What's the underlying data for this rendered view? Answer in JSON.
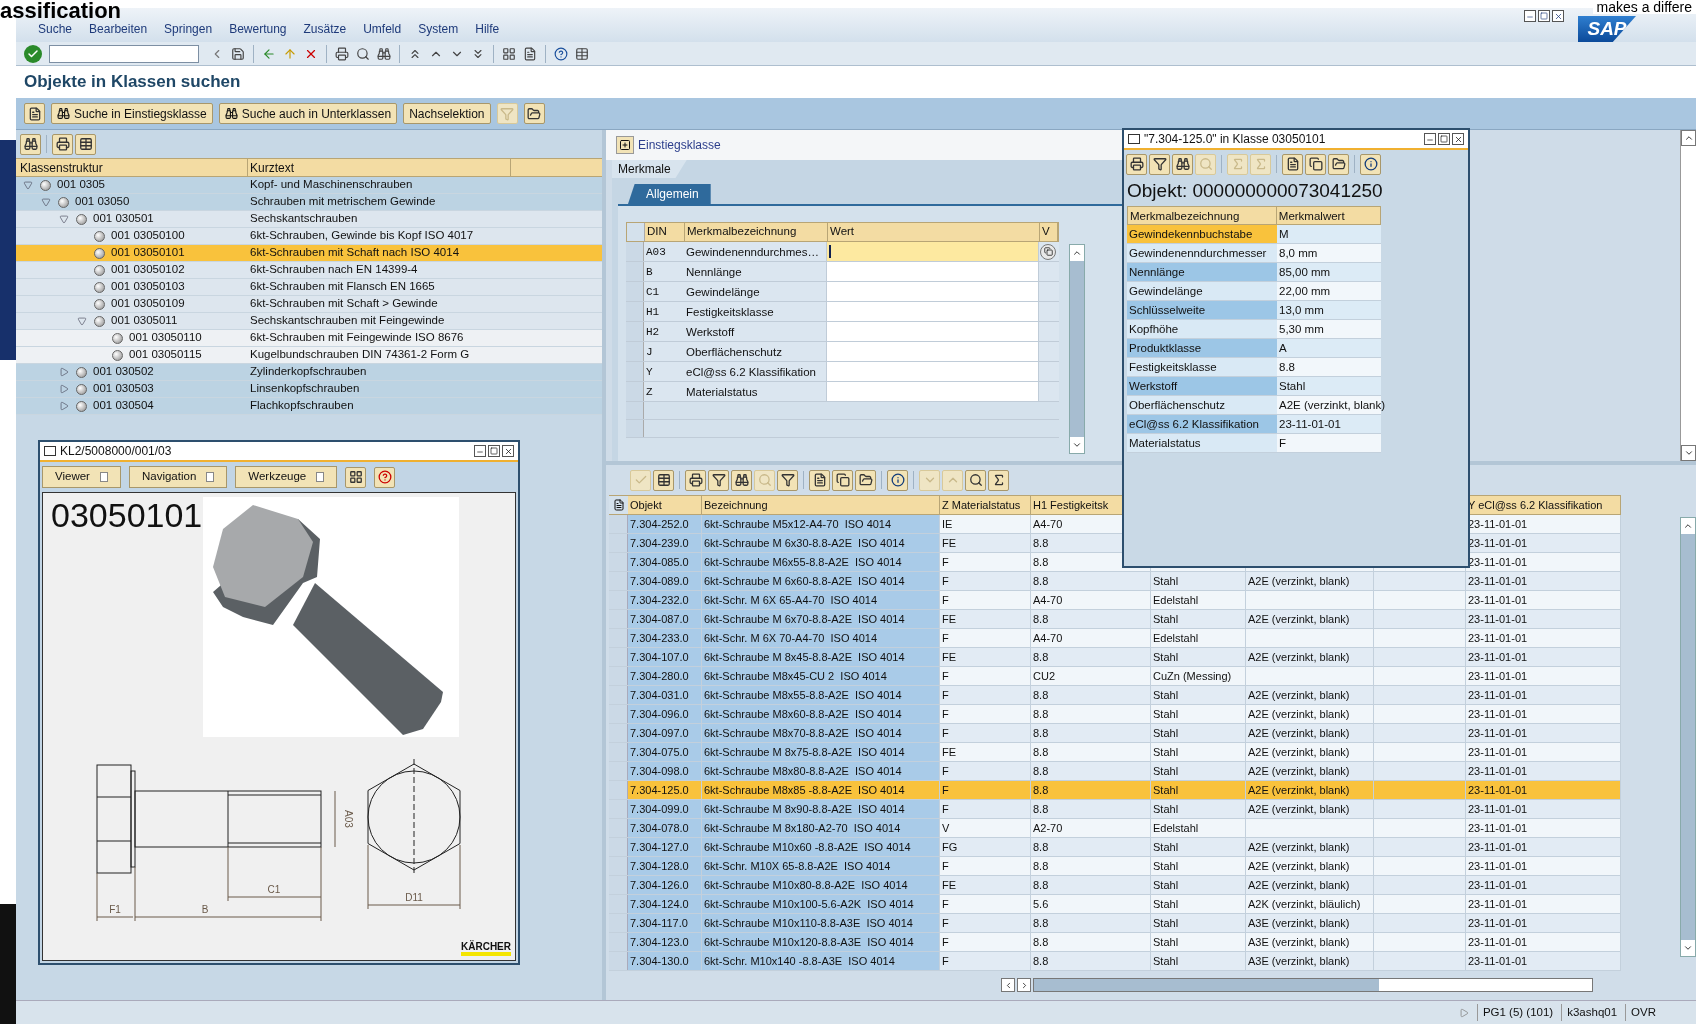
{
  "background_text": [
    "assification",
    "makes a differe"
  ],
  "logo": "SAP",
  "menu": [
    "Suche",
    "Bearbeiten",
    "Springen",
    "Bewertung",
    "Zusätze",
    "Umfeld",
    "System",
    "Hilfe"
  ],
  "title": "Objekte in Klassen suchen",
  "app_toolbar": [
    "Suche in Einstiegsklasse",
    "Suche auch in Unterklassen",
    "Nachselektion"
  ],
  "tree": {
    "columns": [
      "Klassenstruktur",
      "Kurztext"
    ],
    "nodes": [
      {
        "kind": "node",
        "code": "001 0305",
        "text": "Kopf- und Maschinenschrauben",
        "expanded": true,
        "selected": false,
        "children": [
          {
            "kind": "node",
            "code": "001 03050",
            "text": "Schrauben mit metrischem Gewinde",
            "expanded": true,
            "selected": false,
            "children": [
              {
                "kind": "node",
                "code": "001 030501",
                "text": "Sechskantschrauben",
                "expanded": true,
                "selected": false,
                "children": [
                  {
                    "kind": "leaf",
                    "code": "001 03050100",
                    "text": "6kt-Schrauben, Gewinde bis Kopf ISO 4017",
                    "selected": false
                  },
                  {
                    "kind": "leaf",
                    "code": "001 03050101",
                    "text": "6kt-Schrauben mit Schaft nach ISO 4014",
                    "selected": true
                  },
                  {
                    "kind": "leaf",
                    "code": "001 03050102",
                    "text": "6kt-Schrauben nach EN 14399-4",
                    "selected": false
                  },
                  {
                    "kind": "leaf",
                    "code": "001 03050103",
                    "text": "6kt-Schrauben mit Flansch EN 1665",
                    "selected": false
                  },
                  {
                    "kind": "leaf",
                    "code": "001 03050109",
                    "text": "6kt-Schrauben mit Schaft > Gewinde",
                    "selected": false
                  },
                  {
                    "kind": "node",
                    "code": "001 0305011",
                    "text": "Sechskantschrauben mit Feingewinde",
                    "expanded": true,
                    "selected": false,
                    "children": [
                      {
                        "kind": "leaf",
                        "code": "001 03050110",
                        "text": "6kt-Schrauben mit Feingewinde ISO 8676",
                        "selected": false
                      },
                      {
                        "kind": "leaf",
                        "code": "001 03050115",
                        "text": "Kugelbundschrauben DIN 74361-2 Form G",
                        "selected": false
                      }
                    ]
                  }
                ]
              },
              {
                "kind": "node",
                "code": "001 030502",
                "text": "Zylinderkopfschrauben",
                "expanded": false,
                "selected": false
              },
              {
                "kind": "node",
                "code": "001 030503",
                "text": "Linsenkopfschrauben",
                "expanded": false,
                "selected": false
              },
              {
                "kind": "node",
                "code": "001 030504",
                "text": "Flachkopfschrauben",
                "expanded": false,
                "selected": false
              }
            ]
          }
        ]
      }
    ]
  },
  "viewer": {
    "title": "KL2/5008000/001/03",
    "menus": [
      "Viewer",
      "Navigation",
      "Werkzeuge"
    ],
    "document": {
      "number": "03050101",
      "dimension_labels": [
        "A03",
        "C1",
        "D11",
        "F1",
        "B"
      ],
      "logo": "KÄRCHER"
    }
  },
  "characteristics": {
    "entry_class": "Einstiegsklasse",
    "section": "Merkmale",
    "tabs": [
      {
        "label": "Allgemein",
        "selected": true
      }
    ],
    "columns": [
      "DIN",
      "Merkmalbezeichnung",
      "Wert",
      "V"
    ],
    "rows": [
      {
        "din": "A03",
        "name": "Gewindenenndurchmes…",
        "selected": true
      },
      {
        "din": "B",
        "name": "Nennlänge",
        "selected": false
      },
      {
        "din": "C1",
        "name": "Gewindelänge",
        "selected": false
      },
      {
        "din": "H1",
        "name": "Festigkeitsklasse",
        "selected": false
      },
      {
        "din": "H2",
        "name": "Werkstoff",
        "selected": false
      },
      {
        "din": "J",
        "name": "Oberflächenschutz",
        "selected": false
      },
      {
        "din": "Y",
        "name": "eCl@ss 6.2 Klassifikation",
        "selected": false
      },
      {
        "din": "Z",
        "name": "Materialstatus",
        "selected": false
      }
    ]
  },
  "objects": {
    "columns": [
      {
        "label": "Objekt"
      },
      {
        "label": "Bezeichnung"
      },
      {
        "label": "Z Materialstatus"
      },
      {
        "label": "H1 Festigkeitsk"
      },
      {},
      {},
      {},
      {
        "label": "Y eCl@ss 6.2 Klassifikation"
      }
    ],
    "rows": [
      {
        "cells": [
          "7.304-252.0",
          "6kt-Schraube M5x12-A4-70  ISO 4014",
          "IE",
          "A4-70",
          null,
          null,
          null,
          "23-11-01-01"
        ],
        "selected": false
      },
      {
        "cells": [
          "7.304-239.0",
          "6kt-Schraube M 6x30-8.8-A2E  ISO 4014",
          "FE",
          "8.8",
          null,
          null,
          null,
          "23-11-01-01"
        ],
        "selected": false
      },
      {
        "cells": [
          "7.304-085.0",
          "6kt-Schraube M6x55-8.8-A2E  ISO 4014",
          "F",
          "8.8",
          null,
          null,
          null,
          "23-11-01-01"
        ],
        "selected": false
      },
      {
        "cells": [
          "7.304-089.0",
          "6kt-Schraube M 6x60-8.8-A2E  ISO 4014",
          "F",
          "8.8",
          "Stahl",
          "A2E (verzinkt, blank)",
          null,
          "23-11-01-01"
        ],
        "selected": false
      },
      {
        "cells": [
          "7.304-232.0",
          "6kt-Schr. M 6X 65-A4-70  ISO 4014",
          "F",
          "A4-70",
          "Edelstahl",
          null,
          null,
          "23-11-01-01"
        ],
        "selected": false
      },
      {
        "cells": [
          "7.304-087.0",
          "6kt-Schraube M 6x70-8.8-A2E  ISO 4014",
          "FE",
          "8.8",
          "Stahl",
          "A2E (verzinkt, blank)",
          null,
          "23-11-01-01"
        ],
        "selected": false
      },
      {
        "cells": [
          "7.304-233.0",
          "6kt-Schr. M 6X 70-A4-70  ISO 4014",
          "F",
          "A4-70",
          "Edelstahl",
          null,
          null,
          "23-11-01-01"
        ],
        "selected": false
      },
      {
        "cells": [
          "7.304-107.0",
          "6kt-Schraube M 8x45-8.8-A2E  ISO 4014",
          "FE",
          "8.8",
          "Stahl",
          "A2E (verzinkt, blank)",
          null,
          "23-11-01-01"
        ],
        "selected": false
      },
      {
        "cells": [
          "7.304-280.0",
          "6kt-Schraube M8x45-CU 2  ISO 4014",
          "F",
          "CU2",
          "CuZn (Messing)",
          null,
          null,
          "23-11-01-01"
        ],
        "selected": false
      },
      {
        "cells": [
          "7.304-031.0",
          "6kt-Schraube M8x55-8.8-A2E  ISO 4014",
          "F",
          "8.8",
          "Stahl",
          "A2E (verzinkt, blank)",
          null,
          "23-11-01-01"
        ],
        "selected": false
      },
      {
        "cells": [
          "7.304-096.0",
          "6kt-Schraube M8x60-8.8-A2E  ISO 4014",
          "F",
          "8.8",
          "Stahl",
          "A2E (verzinkt, blank)",
          null,
          "23-11-01-01"
        ],
        "selected": false
      },
      {
        "cells": [
          "7.304-097.0",
          "6kt-Schraube M8x70-8.8-A2E  ISO 4014",
          "F",
          "8.8",
          "Stahl",
          "A2E (verzinkt, blank)",
          null,
          "23-11-01-01"
        ],
        "selected": false
      },
      {
        "cells": [
          "7.304-075.0",
          "6kt-Schraube M 8x75-8.8-A2E  ISO 4014",
          "FE",
          "8.8",
          "Stahl",
          "A2E (verzinkt, blank)",
          null,
          "23-11-01-01"
        ],
        "selected": false
      },
      {
        "cells": [
          "7.304-098.0",
          "6kt-Schraube M8x80-8.8-A2E  ISO 4014",
          "F",
          "8.8",
          "Stahl",
          "A2E (verzinkt, blank)",
          null,
          "23-11-01-01"
        ],
        "selected": false
      },
      {
        "cells": [
          "7.304-125.0",
          "6kt-Schraube M8x85 -8.8-A2E  ISO 4014",
          "F",
          "8.8",
          "Stahl",
          "A2E (verzinkt, blank)",
          null,
          "23-11-01-01"
        ],
        "selected": true
      },
      {
        "cells": [
          "7.304-099.0",
          "6kt-Schraube M 8x90-8.8-A2E  ISO 4014",
          "F",
          "8.8",
          "Stahl",
          "A2E (verzinkt, blank)",
          null,
          "23-11-01-01"
        ],
        "selected": false
      },
      {
        "cells": [
          "7.304-078.0",
          "6kt-Schraube M 8x180-A2-70  ISO 4014",
          "V",
          "A2-70",
          "Edelstahl",
          null,
          null,
          "23-11-01-01"
        ],
        "selected": false
      },
      {
        "cells": [
          "7.304-127.0",
          "6kt-Schraube M10x60 -8.8-A2E  ISO 4014",
          "FG",
          "8.8",
          "Stahl",
          "A2E (verzinkt, blank)",
          null,
          "23-11-01-01"
        ],
        "selected": false
      },
      {
        "cells": [
          "7.304-128.0",
          "6kt-Schr. M10X 65-8.8-A2E  ISO 4014",
          "F",
          "8.8",
          "Stahl",
          "A2E (verzinkt, blank)",
          null,
          "23-11-01-01"
        ],
        "selected": false
      },
      {
        "cells": [
          "7.304-126.0",
          "6kt-Schraube M10x80-8.8-A2E  ISO 4014",
          "FE",
          "8.8",
          "Stahl",
          "A2E (verzinkt, blank)",
          null,
          "23-11-01-01"
        ],
        "selected": false
      },
      {
        "cells": [
          "7.304-124.0",
          "6kt-Schraube M10x100-5.6-A2K  ISO 4014",
          "F",
          "5.6",
          "Stahl",
          "A2K (verzinkt, bläulich)",
          null,
          "23-11-01-01"
        ],
        "selected": false
      },
      {
        "cells": [
          "7.304-117.0",
          "6kt-Schraube M10x110-8.8-A3E  ISO 4014",
          "F",
          "8.8",
          "Stahl",
          "A3E (verzinkt, blank)",
          null,
          "23-11-01-01"
        ],
        "selected": false
      },
      {
        "cells": [
          "7.304-123.0",
          "6kt-Schraube M10x120-8.8-A3E  ISO 4014",
          "F",
          "8.8",
          "Stahl",
          "A3E (verzinkt, blank)",
          null,
          "23-11-01-01"
        ],
        "selected": false
      },
      {
        "cells": [
          "7.304-130.0",
          "6kt-Schr. M10x140 -8.8-A3E  ISO 4014",
          "F",
          "8.8",
          "Stahl",
          "A3E (verzinkt, blank)",
          null,
          "23-11-01-01"
        ],
        "selected": false
      }
    ]
  },
  "object_popup": {
    "title": "\"7.304-125.0\" in Klasse 03050101",
    "heading": "Objekt: 000000000073041250",
    "columns": [
      "Merkmalbezeichnung",
      "Merkmalwert"
    ],
    "rows": [
      {
        "name": "Gewindekennbuchstabe",
        "value": "M",
        "selected": true
      },
      {
        "name": "Gewindenenndurchmesser",
        "value": "8,0 mm",
        "selected": false
      },
      {
        "name": "Nennlänge",
        "value": "85,00 mm",
        "selected": false
      },
      {
        "name": "Gewindelänge",
        "value": "22,00 mm",
        "selected": false
      },
      {
        "name": "Schlüsselweite",
        "value": "13,0 mm",
        "selected": false
      },
      {
        "name": "Kopfhöhe",
        "value": "5,30 mm",
        "selected": false
      },
      {
        "name": "Produktklasse",
        "value": "A",
        "selected": false
      },
      {
        "name": "Festigkeitsklasse",
        "value": "8.8",
        "selected": false
      },
      {
        "name": "Werkstoff",
        "value": "Stahl",
        "selected": false
      },
      {
        "name": "Oberflächenschutz",
        "value": "A2E (verzinkt, blank)",
        "selected": false
      },
      {
        "name": "eCl@ss 6.2 Klassifikation",
        "value": "23-11-01-01",
        "selected": false
      },
      {
        "name": "Materialstatus",
        "value": "F",
        "selected": false
      }
    ]
  },
  "status_bar": [
    "PG1 (5) (101)",
    "k3ashq01",
    "OVR"
  ]
}
